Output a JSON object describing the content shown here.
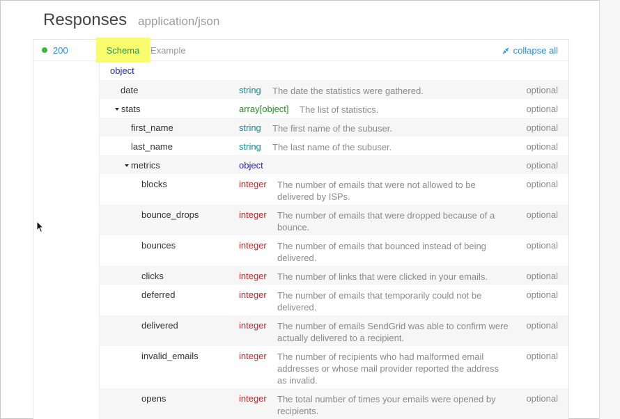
{
  "header": {
    "title": "Responses",
    "content_type": "application/json"
  },
  "status": {
    "code": "200",
    "color": "#3cb83c"
  },
  "tabs": {
    "schema": "Schema",
    "example": "Example"
  },
  "collapse_all": "collapse all",
  "root_type": "object",
  "rows": [
    {
      "name": "date",
      "type": "string",
      "desc": [
        "The date the statistics were gathered."
      ],
      "opt": "optional"
    },
    {
      "name": "stats",
      "type": "array[object]",
      "desc": [
        "The list of statistics."
      ],
      "opt": "optional"
    },
    {
      "name": "first_name",
      "type": "string",
      "desc": [
        "The first name of the subuser."
      ],
      "opt": "optional"
    },
    {
      "name": "last_name",
      "type": "string",
      "desc": [
        "The last name of the subuser."
      ],
      "opt": "optional"
    },
    {
      "name": "metrics",
      "type": "object",
      "desc": [
        ""
      ],
      "opt": "optional"
    },
    {
      "name": "blocks",
      "type": "integer",
      "desc": [
        "The number of emails that were not allowed to be",
        "delivered by ISPs."
      ],
      "opt": "optional"
    },
    {
      "name": "bounce_drops",
      "type": "integer",
      "desc": [
        "The number of emails that were dropped because of a",
        "bounce."
      ],
      "opt": "optional"
    },
    {
      "name": "bounces",
      "type": "integer",
      "desc": [
        "The number of emails that bounced instead of being",
        "delivered."
      ],
      "opt": "optional"
    },
    {
      "name": "clicks",
      "type": "integer",
      "desc": [
        "The number of links that were clicked in your emails."
      ],
      "opt": "optional"
    },
    {
      "name": "deferred",
      "type": "integer",
      "desc": [
        "The number of emails that temporarily could not be",
        "delivered."
      ],
      "opt": "optional"
    },
    {
      "name": "delivered",
      "type": "integer",
      "desc": [
        "The number of emails SendGrid was able to confirm were",
        "actually delivered to a recipient."
      ],
      "opt": "optional"
    },
    {
      "name": "invalid_emails",
      "type": "integer",
      "desc": [
        "The number of recipients who had malformed email",
        "addresses or whose mail provider reported the address",
        "as invalid."
      ],
      "opt": "optional"
    },
    {
      "name": "opens",
      "type": "integer",
      "desc": [
        "The total number of times your emails were opened by",
        "recipients."
      ],
      "opt": "optional"
    }
  ]
}
